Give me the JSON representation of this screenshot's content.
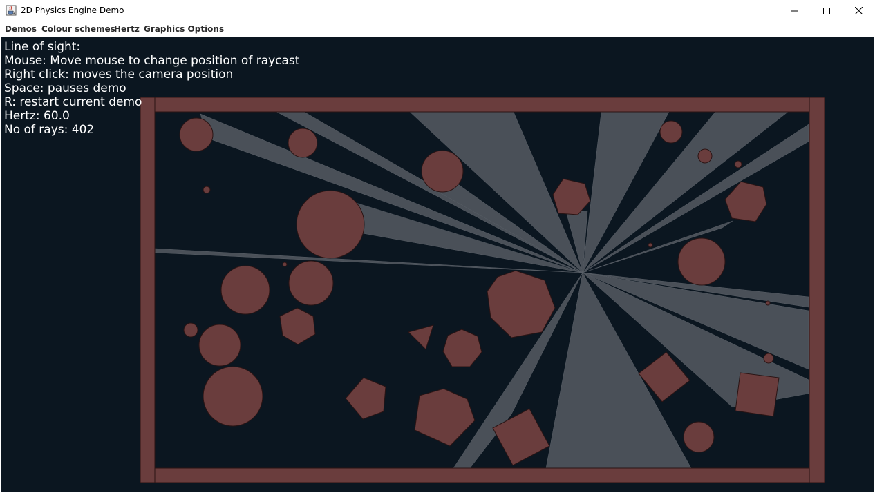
{
  "window": {
    "title": "2D Physics Engine Demo",
    "icon": "java-cup-icon",
    "controls": [
      "minimize-icon",
      "maximize-icon",
      "close-icon"
    ]
  },
  "menu": {
    "items": [
      {
        "label": "Demos"
      },
      {
        "label": "Colour schemes"
      },
      {
        "label": "Hertz"
      },
      {
        "label": "Graphics Options"
      }
    ]
  },
  "hud": {
    "line1": "Line of sight:",
    "line2": "Mouse: Move mouse to change position of raycast",
    "line3": "Right click: moves the camera position",
    "line4": "Space: pauses demo",
    "line5": "R: restart current demo",
    "line6": "Hertz: 60.0",
    "line7": "No of rays: 402"
  },
  "colors": {
    "background": "#0b1620",
    "body_fill": "#6a3d3d",
    "body_stroke": "#2a1414",
    "ray_fill": "#4a5058"
  }
}
